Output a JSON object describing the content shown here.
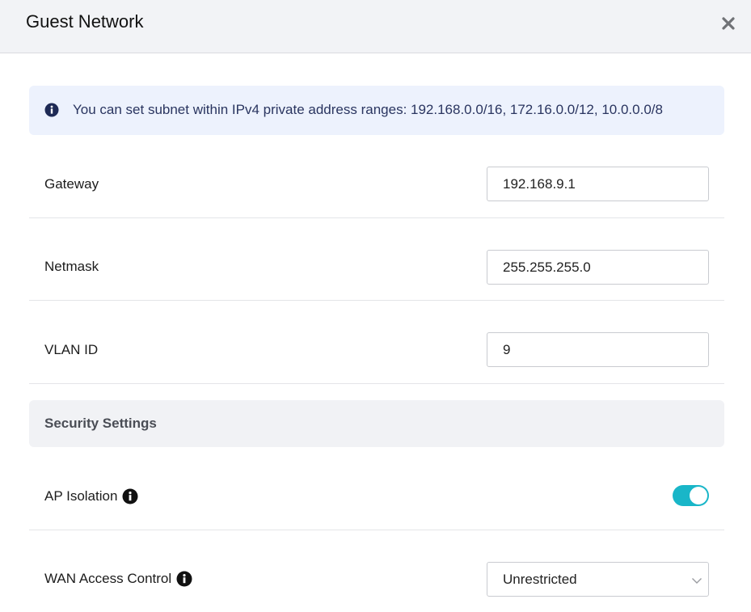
{
  "dialog": {
    "title": "Guest Network",
    "close_icon": "close-icon"
  },
  "notice": {
    "icon": "info-icon",
    "text": "You can set subnet within IPv4 private address ranges: 192.168.0.0/16, 172.16.0.0/12, 10.0.0.0/8"
  },
  "fields": {
    "gateway": {
      "label": "Gateway",
      "value": "192.168.9.1"
    },
    "netmask": {
      "label": "Netmask",
      "value": "255.255.255.0"
    },
    "vlan": {
      "label": "VLAN ID",
      "value": "9"
    }
  },
  "security": {
    "title": "Security Settings",
    "ap_isolation": {
      "label": "AP Isolation",
      "help_icon": "info-circle-icon",
      "enabled": true
    },
    "wan_access": {
      "label": "WAN Access Control",
      "help_icon": "info-circle-icon",
      "value": "Unrestricted",
      "dropdown_icon": "chevron-down-icon"
    }
  },
  "colors": {
    "accent": "#19b6c8",
    "notice_bg": "#edf2fd",
    "notice_text": "#2a3560",
    "header_bg": "#f2f3f6"
  }
}
